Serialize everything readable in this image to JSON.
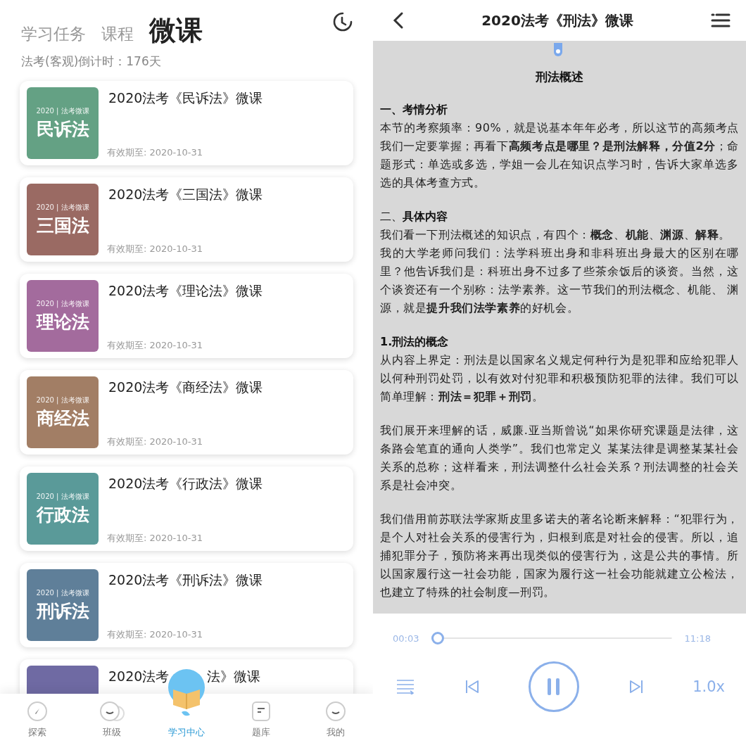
{
  "left": {
    "tabs": [
      {
        "label": "学习任务",
        "selected": false
      },
      {
        "label": "课程",
        "selected": false
      },
      {
        "label": "微课",
        "selected": true
      }
    ],
    "countdown": "法考(客观)倒计时：176天",
    "courses": [
      {
        "title": "2020法考《民诉法》微课",
        "cover_caption": "2020 | 法考微课",
        "cover_title": "民诉法",
        "color": "#64a184",
        "expiry": "有效期至: 2020-10-31"
      },
      {
        "title": "2020法考《三国法》微课",
        "cover_caption": "2020 | 法考微课",
        "cover_title": "三国法",
        "color": "#9a6a63",
        "expiry": "有效期至: 2020-10-31"
      },
      {
        "title": "2020法考《理论法》微课",
        "cover_caption": "2020 | 法考微课",
        "cover_title": "理论法",
        "color": "#a36b9d",
        "expiry": "有效期至: 2020-10-31"
      },
      {
        "title": "2020法考《商经法》微课",
        "cover_caption": "2020 | 法考微课",
        "cover_title": "商经法",
        "color": "#a27e65",
        "expiry": "有效期至: 2020-10-31"
      },
      {
        "title": "2020法考《行政法》微课",
        "cover_caption": "2020 | 法考微课",
        "cover_title": "行政法",
        "color": "#5a9a99",
        "expiry": "有效期至: 2020-10-31"
      },
      {
        "title": "2020法考《刑诉法》微课",
        "cover_caption": "2020 | 法考微课",
        "cover_title": "刑诉法",
        "color": "#5f7f99",
        "expiry": "有效期至: 2020-10-31"
      },
      {
        "title_pieces": [
          "2020法考",
          "法》微课"
        ],
        "color": "#6f6aa3",
        "cut": true
      }
    ],
    "nav": [
      {
        "label": "探索",
        "kind": "compass",
        "selected": false
      },
      {
        "label": "班级",
        "kind": "class",
        "selected": false
      },
      {
        "label": "学习中心",
        "kind": "mascot",
        "selected": true
      },
      {
        "label": "题库",
        "kind": "bank",
        "selected": false
      },
      {
        "label": "我的",
        "kind": "me",
        "selected": false
      }
    ]
  },
  "right": {
    "title": "2020法考《刑法》微课",
    "article_title": "刑法概述",
    "sections": [
      {
        "heading": "一、考情分析",
        "paragraphs": [
          "本节的考察频率：90%，就是说基本年年必考，所以这节的高频考点我们一定要掌握；再看下**高频考点是哪里？是刑法解释，分值2分**；命题形式：单选或多选，学姐一会儿在知识点学习时，告诉大家单选多选的具体考查方式。"
        ]
      },
      {
        "heading": "二、**具体内容**",
        "paragraphs": [
          "我们看一下刑法概述的知识点，有四个：**概念**、**机能**、**渊源**、**解释**。",
          "我的大学老师问我们：法学科班出身和非科班出身最大的区别在哪里？他告诉我们是：科班出身不过多了些茶余饭后的谈资。当然，这个谈资还有一个别称：法学素养。这一节我们的刑法概念、机能、 渊源，就是**提升我们法学素养**的好机会。"
        ]
      },
      {
        "heading": "1.刑法的概念",
        "paragraphs": [
          "从内容上界定：刑法是以国家名义规定何种行为是犯罪和应给犯罪人以何种刑罚处罚，以有效对付犯罪和积极预防犯罪的法律。我们可以简单理解：**刑法＝犯罪＋刑罚**。"
        ]
      },
      {
        "paragraphs": [
          "我们展开来理解的话，威廉.亚当斯曾说“如果你研究课题是法律，这条路会笔直的通向人类学”。我们也常定义 某某法律是调整某某社会关系的总称；这样看来，刑法调整什么社会关系？刑法调整的社会关系是社会冲突。"
        ]
      },
      {
        "paragraphs": [
          "我们借用前苏联法学家斯皮里多诺夫的著名论断来解释：“犯罪行为，是个人对社会关系的侵害行为，归根到底是对社会的侵害。所以，追捕犯罪分子，预防将来再出现类似的侵害行为，这是公共的事情。所以国家履行这一社会功能，国家为履行这一社会功能就建立公检法，也建立了特殊的社会制度—刑罚。"
        ]
      }
    ],
    "player": {
      "elapsed": "00:03",
      "level": 0.0,
      "duration": "11:18",
      "playing": true,
      "speed": "1.0x"
    }
  }
}
